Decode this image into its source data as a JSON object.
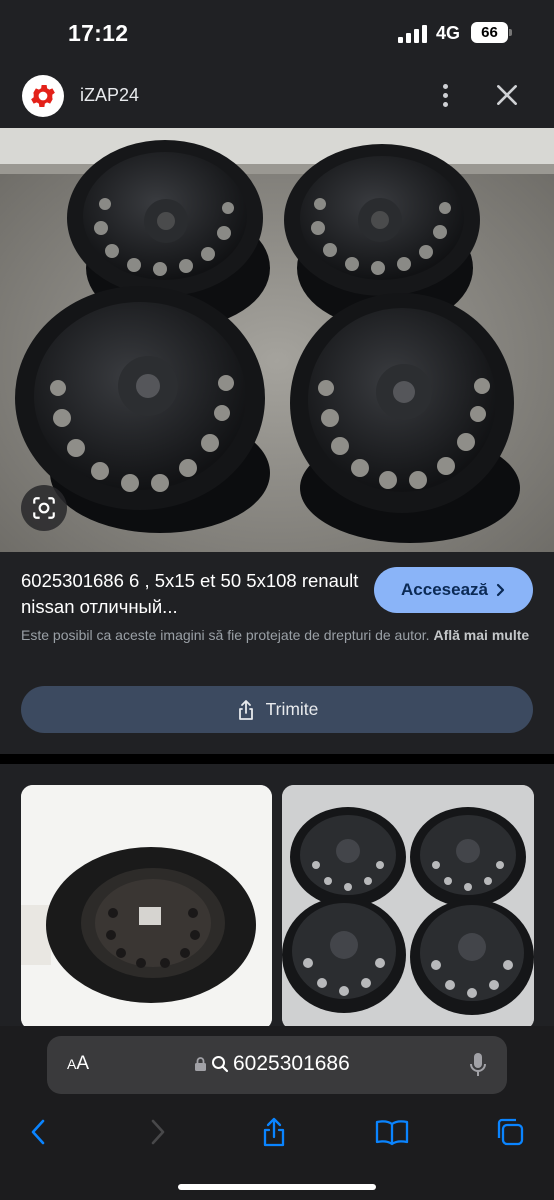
{
  "status": {
    "time": "17:12",
    "network": "4G",
    "battery": "66"
  },
  "header": {
    "site_name": "iZAP24",
    "logo_icon": "gear-icon",
    "more_icon": "more-vertical-icon",
    "close_icon": "close-icon"
  },
  "result": {
    "title": "6025301686 6 , 5x15 et 50 5x108 renault nissan отличный...",
    "visit_label": "Accesează",
    "copyright_text": "Este posibil ca aceste imagini să fie protejate de drepturi de autor.",
    "learn_more": "Află mai multe",
    "share_label": "Trimite"
  },
  "address_bar": {
    "aa_label_small": "A",
    "aa_label_large": "A",
    "query": "6025301686"
  },
  "colors": {
    "panel_bg": "#202124",
    "accent_button": "#8ab4f8",
    "share_button": "#3c4a60",
    "toolbar_bg": "#1c1c1e",
    "ios_blue": "#0a84ff"
  }
}
